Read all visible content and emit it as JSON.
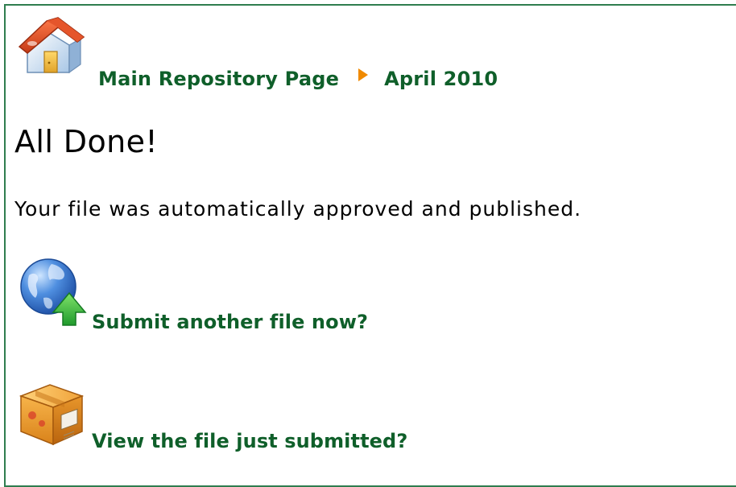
{
  "breadcrumb": {
    "items": [
      {
        "label": "Main Repository Page"
      },
      {
        "label": "April 2010"
      }
    ],
    "separator_color": "#f08a00"
  },
  "page": {
    "title": "All Done!",
    "message": "Your file was automatically approved and published."
  },
  "actions": {
    "submit_another": {
      "label": "Submit another file now?",
      "icon": "globe-upload-icon"
    },
    "view_submitted": {
      "label": "View the file just submitted?",
      "icon": "package-box-icon"
    }
  },
  "colors": {
    "link": "#0f5f2a",
    "frame_border": "#2f7d4f",
    "text": "#000000"
  }
}
